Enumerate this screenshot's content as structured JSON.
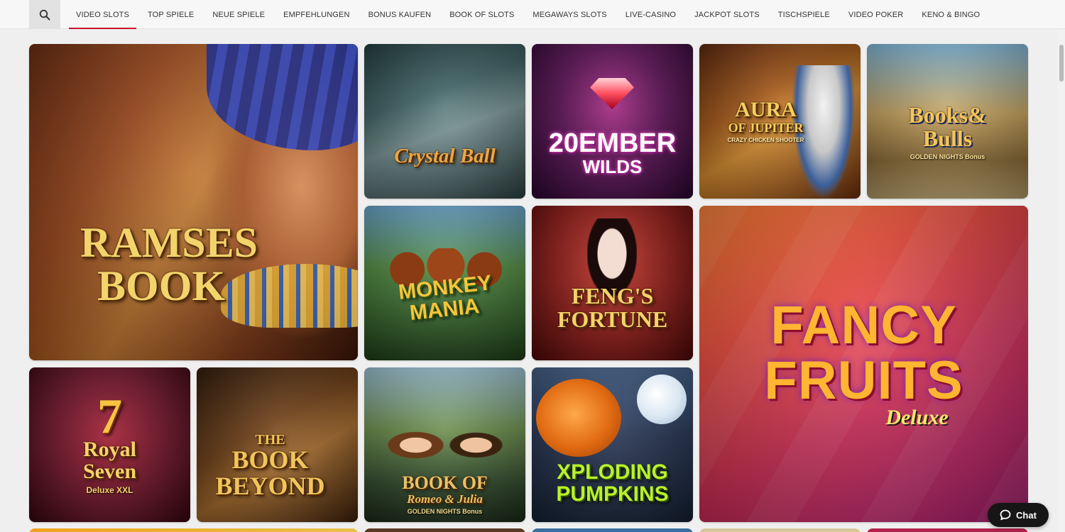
{
  "nav": {
    "search_icon": "search-icon",
    "tabs": [
      {
        "label": "VIDEO SLOTS",
        "active": true
      },
      {
        "label": "TOP SPIELE"
      },
      {
        "label": "NEUE SPIELE"
      },
      {
        "label": "EMPFEHLUNGEN"
      },
      {
        "label": "BONUS KAUFEN"
      },
      {
        "label": "BOOK OF SLOTS"
      },
      {
        "label": "MEGAWAYS SLOTS"
      },
      {
        "label": "LIVE-CASINO"
      },
      {
        "label": "JACKPOT SLOTS"
      },
      {
        "label": "TISCHSPIELE"
      },
      {
        "label": "VIDEO POKER"
      },
      {
        "label": "KENO & BINGO"
      }
    ],
    "active_color": "#c8102e"
  },
  "games": {
    "ramses": {
      "title_line1": "RAMSES",
      "title_line2": "BOOK"
    },
    "crystal": {
      "title": "Crystal Ball"
    },
    "ember": {
      "title_line1": "20EMBER",
      "title_line2": "WILDS"
    },
    "aura": {
      "title_line1": "AURA",
      "title_line2": "OF JUPITER",
      "badge": "CRAZY CHICKEN SHOOTER"
    },
    "books": {
      "title_line1": "Books&",
      "title_line2": "Bulls",
      "badge": "GOLDEN NIGHTS Bonus"
    },
    "monkey": {
      "title_line1": "MONKEY",
      "title_line2": "MANIA"
    },
    "feng": {
      "title_line1": "FENG'S",
      "title_line2": "FORTUNE"
    },
    "fancy": {
      "title_line1": "FANCY",
      "title_line2": "FRUITS",
      "subtitle": "Deluxe"
    },
    "royal": {
      "number": "7",
      "title_line1": "Royal",
      "title_line2": "Seven",
      "subtitle": "Deluxe XXL"
    },
    "beyond": {
      "title_line1": "THE",
      "title_line2": "BOOK",
      "title_line3": "BEYOND"
    },
    "romeo": {
      "title_line1": "BOOK OF",
      "title_line2": "Romeo & Julia",
      "badge": "GOLDEN NIGHTS Bonus"
    },
    "pumpkins": {
      "title_line1": "XPLODING",
      "title_line2": "PUMPKINS"
    }
  },
  "chat": {
    "label": "Chat",
    "icon": "chat-bubble-icon"
  }
}
